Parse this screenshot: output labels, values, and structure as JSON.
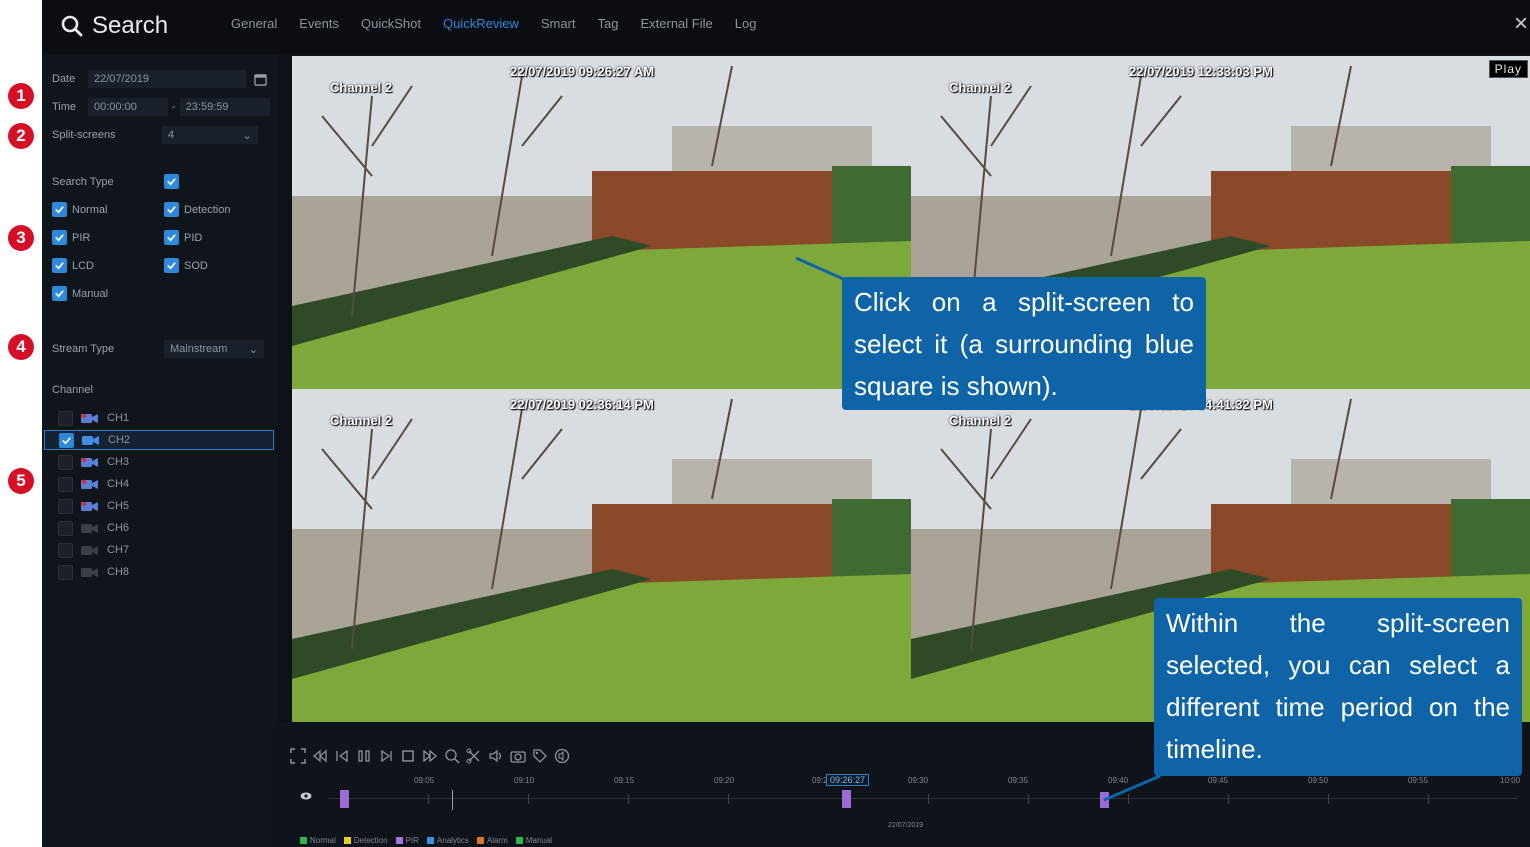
{
  "topbar": {
    "title": "Search",
    "tabs": [
      "General",
      "Events",
      "QuickShot",
      "QuickReview",
      "Smart",
      "Tag",
      "External File",
      "Log"
    ],
    "active_tab": "QuickReview",
    "close": "×"
  },
  "sidebar": {
    "date_label": "Date",
    "date_value": "22/07/2019",
    "time_label": "Time",
    "time_start": "00:00:00",
    "time_sep": "-",
    "time_end": "23:59:59",
    "split_label": "Split-screens",
    "split_value": "4",
    "search_type_label": "Search Type",
    "types": [
      {
        "label": "Normal",
        "checked": true
      },
      {
        "label": "Detection",
        "checked": true
      },
      {
        "label": "PIR",
        "checked": true
      },
      {
        "label": "PID",
        "checked": true
      },
      {
        "label": "LCD",
        "checked": true
      },
      {
        "label": "SOD",
        "checked": true
      },
      {
        "label": "Manual",
        "checked": true
      }
    ],
    "stream_label": "Stream Type",
    "stream_value": "Mainstream",
    "channel_label": "Channel",
    "channels": [
      {
        "label": "CH1",
        "checked": false,
        "cam": "red"
      },
      {
        "label": "CH2",
        "checked": true,
        "cam": "blue"
      },
      {
        "label": "CH3",
        "checked": false,
        "cam": "red"
      },
      {
        "label": "CH4",
        "checked": false,
        "cam": "red"
      },
      {
        "label": "CH5",
        "checked": false,
        "cam": "red"
      },
      {
        "label": "CH6",
        "checked": false,
        "cam": "gray"
      },
      {
        "label": "CH7",
        "checked": false,
        "cam": "gray"
      },
      {
        "label": "CH8",
        "checked": false,
        "cam": "gray"
      }
    ]
  },
  "tiles": [
    {
      "channel": "Channel 2",
      "timestamp": "22/07/2019 09:26:27 AM",
      "selected": true
    },
    {
      "channel": "Channel 2",
      "timestamp": "22/07/2019 12:33:03 PM",
      "selected": false
    },
    {
      "channel": "Channel 2",
      "timestamp": "22/07/2019 02:36:14 PM",
      "selected": false
    },
    {
      "channel": "Channel 2",
      "timestamp": "22/07/2019 04:41:32 PM",
      "selected": false
    }
  ],
  "play_badge": "Play",
  "timeline": {
    "ticks": [
      "09:05",
      "09:10",
      "09:15",
      "09:20",
      "09:25",
      "09:30",
      "09:35",
      "09:40",
      "09:45",
      "09:50",
      "09:55",
      "10:00"
    ],
    "cursor": "09:26:27",
    "date": "22/07/2019",
    "legend": [
      {
        "label": "Normal",
        "color": "#2fb84f"
      },
      {
        "label": "Detection",
        "color": "#e6d21e"
      },
      {
        "label": "PIR",
        "color": "#a970e0"
      },
      {
        "label": "Analytics",
        "color": "#3a8fe0"
      },
      {
        "label": "Alarm",
        "color": "#e0742a"
      },
      {
        "label": "Manual",
        "color": "#2fb84f"
      }
    ]
  },
  "callouts": {
    "select": "Click on a split-screen to select it (a surrounding blue square is shown).",
    "timeline": "Within the split-screen selected, you can select a different time period on the timeline."
  },
  "numbers": [
    "1",
    "2",
    "3",
    "4",
    "5"
  ],
  "colors": {
    "accent": "#2d8ae0",
    "callout": "#0e64a6",
    "badge": "#d50f26",
    "pir": "#9d6ad8"
  }
}
